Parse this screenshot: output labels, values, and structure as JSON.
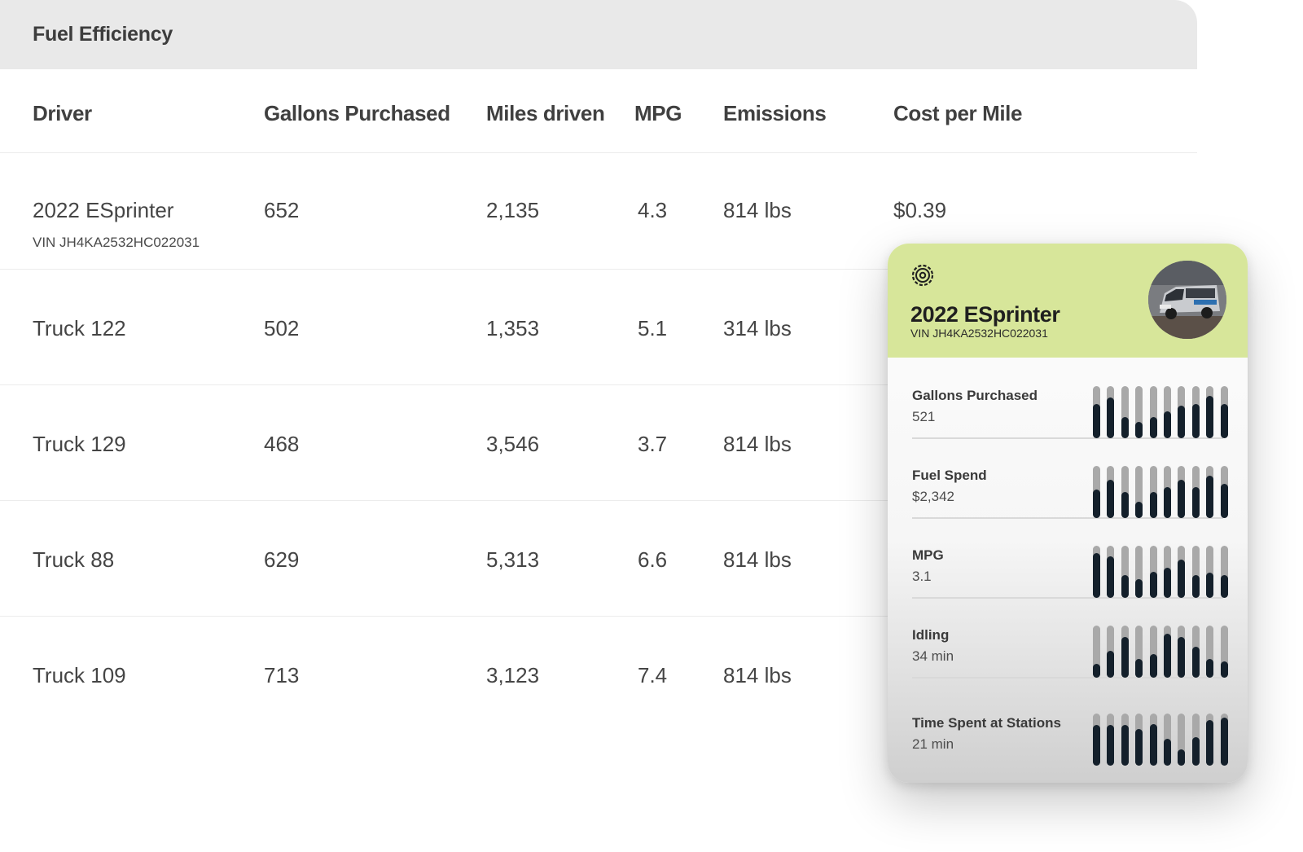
{
  "panel": {
    "title": "Fuel Efficiency"
  },
  "table": {
    "headers": [
      "Driver",
      "Gallons Purchased",
      "Miles driven",
      "MPG",
      "Emissions",
      "Cost per Mile"
    ],
    "rows": [
      {
        "driver": "2022 ESprinter",
        "vin": "VIN JH4KA2532HC022031",
        "gallons": "652",
        "miles": "2,135",
        "mpg": "4.3",
        "emissions": "814 lbs",
        "cost": "$0.39"
      },
      {
        "driver": "Truck 122",
        "vin": "",
        "gallons": "502",
        "miles": "1,353",
        "mpg": "5.1",
        "emissions": "314 lbs",
        "cost": ""
      },
      {
        "driver": "Truck 129",
        "vin": "",
        "gallons": "468",
        "miles": "3,546",
        "mpg": "3.7",
        "emissions": "814 lbs",
        "cost": ""
      },
      {
        "driver": "Truck 88",
        "vin": "",
        "gallons": "629",
        "miles": "5,313",
        "mpg": "6.6",
        "emissions": "814 lbs",
        "cost": ""
      },
      {
        "driver": "Truck 109",
        "vin": "",
        "gallons": "713",
        "miles": "3,123",
        "mpg": "7.4",
        "emissions": "814 lbs",
        "cost": ""
      }
    ]
  },
  "card": {
    "title": "2022 ESprinter",
    "vin": "VIN JH4KA2532HC022031",
    "icon": "gear-icon",
    "avatar": "van-photo",
    "metrics": [
      {
        "label": "Gallons Purchased",
        "value": "521",
        "bars": [
          0.66,
          0.78,
          0.4,
          0.32,
          0.4,
          0.52,
          0.62,
          0.66,
          0.82,
          0.66
        ]
      },
      {
        "label": "Fuel Spend",
        "value": "$2,342",
        "bars": [
          0.55,
          0.74,
          0.5,
          0.32,
          0.5,
          0.6,
          0.74,
          0.6,
          0.82,
          0.66
        ]
      },
      {
        "label": "MPG",
        "value": "3.1",
        "bars": [
          0.86,
          0.8,
          0.44,
          0.36,
          0.5,
          0.58,
          0.74,
          0.44,
          0.48,
          0.44
        ]
      },
      {
        "label": "Idling",
        "value": "34 min",
        "bars": [
          0.26,
          0.52,
          0.78,
          0.36,
          0.46,
          0.84,
          0.78,
          0.6,
          0.36,
          0.32
        ]
      },
      {
        "label": "Time Spent at Stations",
        "value": "21 min",
        "bars": [
          0.78,
          0.78,
          0.78,
          0.7,
          0.8,
          0.52,
          0.32,
          0.55,
          0.88,
          0.92
        ]
      }
    ],
    "colors": {
      "header": "#d7e69a",
      "bar_fill": "#14202b",
      "bar_track": "#a9a9a9"
    }
  }
}
